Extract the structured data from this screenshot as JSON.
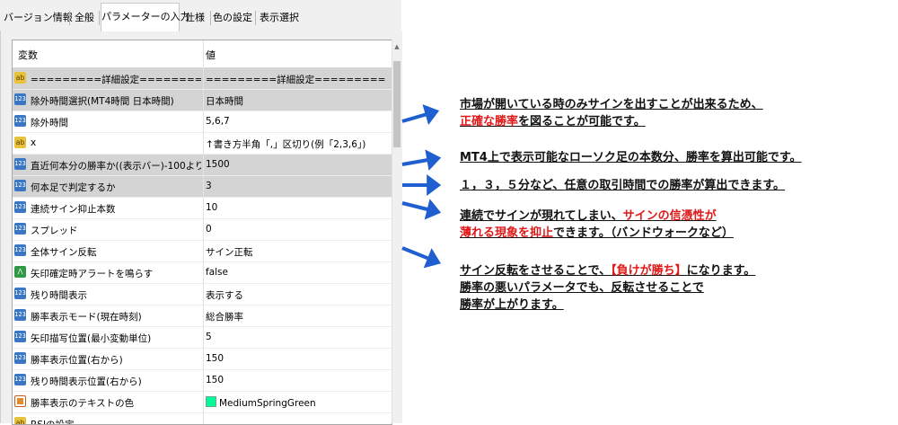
{
  "tabs": [
    "バージョン情報",
    "全般",
    "パラメーターの入力",
    "仕様",
    "色の設定",
    "表示選択"
  ],
  "active_tab": "パラメーターの入力",
  "grid": {
    "header_name": "変数",
    "header_value": "値",
    "rows": [
      {
        "icon": "ab",
        "name": "=========詳細設定=========",
        "value": "=========詳細設定=========",
        "selected": true
      },
      {
        "icon": "123",
        "name": "除外時間選択(MT4時間 日本時間)",
        "value": "日本時間",
        "selected": true
      },
      {
        "icon": "123",
        "name": "除外時間",
        "value": "5,6,7",
        "selected": false
      },
      {
        "icon": "ab",
        "name": "x",
        "value": "↑書き方半角「,」区切り(例「2,3,6」)",
        "selected": false
      },
      {
        "icon": "123",
        "name": "直近何本分の勝率か((表示バー)-100より多いとエ...",
        "value": "1500",
        "selected": true
      },
      {
        "icon": "123",
        "name": "何本足で判定するか",
        "value": "3",
        "selected": true
      },
      {
        "icon": "123",
        "name": "連続サイン抑止本数",
        "value": "10",
        "selected": false
      },
      {
        "icon": "123",
        "name": "スプレッド",
        "value": "0",
        "selected": false
      },
      {
        "icon": "123",
        "name": "全体サイン反転",
        "value": "サイン正転",
        "selected": false
      },
      {
        "icon": "bool",
        "name": "矢印確定時アラートを鳴らす",
        "value": "false",
        "selected": false
      },
      {
        "icon": "123",
        "name": "残り時間表示",
        "value": "表示する",
        "selected": false
      },
      {
        "icon": "123",
        "name": "勝率表示モード(現在時刻)",
        "value": "総合勝率",
        "selected": false
      },
      {
        "icon": "123",
        "name": "矢印描写位置(最小変動単位)",
        "value": "5",
        "selected": false
      },
      {
        "icon": "123",
        "name": "勝率表示位置(右から)",
        "value": "150",
        "selected": false
      },
      {
        "icon": "123",
        "name": "残り時間表示位置(右から)",
        "value": "150",
        "selected": false
      },
      {
        "icon": "color",
        "name": "勝率表示のテキストの色",
        "value": "MediumSpringGreen",
        "selected": false
      },
      {
        "icon": "ab",
        "name": "RSIの設定",
        "value": "",
        "selected": false
      }
    ]
  },
  "annotations": {
    "a1_line1": "市場が開いている時のみサインを出すことが出来るため、",
    "a1_line2_red": "正確な勝率",
    "a1_line2_rest": "を図ることが可能です。",
    "a2": "MT4上で表示可能なローソク足の本数分、勝率を算出可能です。",
    "a3": "１，３，５分など、任意の取引時間での勝率が算出できます。",
    "a4_line1_pre": "連続でサインが現れてしまい、",
    "a4_line1_red": "サインの信憑性が",
    "a4_line2_red": "薄れる現象を抑止",
    "a4_line2_rest": "できます。（バンドウォークなど）",
    "a5_line1_pre": "サイン反転をさせることで、",
    "a5_line1_red": "【負けが勝ち】",
    "a5_line1_rest": "になります。",
    "a5_line2": "勝率の悪いパラメータでも、反転させることで",
    "a5_line3": "勝率が上がります。"
  },
  "colors": {
    "arrow": "#1f5fcf",
    "highlight_red": "#e01818",
    "selected_row": "#d4d4d4",
    "swatch": "#00fa9a"
  }
}
